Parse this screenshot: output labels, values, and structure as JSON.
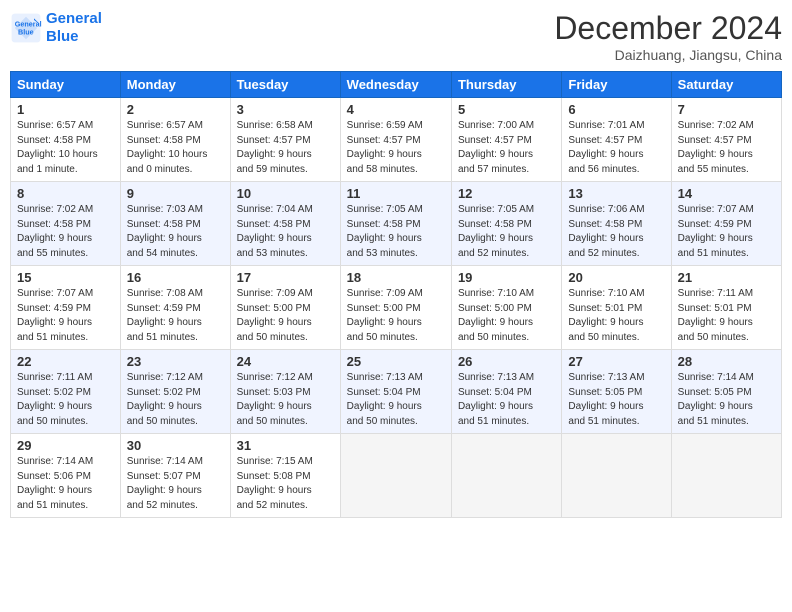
{
  "header": {
    "logo_line1": "General",
    "logo_line2": "Blue",
    "month": "December 2024",
    "location": "Daizhuang, Jiangsu, China"
  },
  "weekdays": [
    "Sunday",
    "Monday",
    "Tuesday",
    "Wednesday",
    "Thursday",
    "Friday",
    "Saturday"
  ],
  "weeks": [
    [
      {
        "day": "1",
        "info": "Sunrise: 6:57 AM\nSunset: 4:58 PM\nDaylight: 10 hours\nand 1 minute."
      },
      {
        "day": "2",
        "info": "Sunrise: 6:57 AM\nSunset: 4:58 PM\nDaylight: 10 hours\nand 0 minutes."
      },
      {
        "day": "3",
        "info": "Sunrise: 6:58 AM\nSunset: 4:57 PM\nDaylight: 9 hours\nand 59 minutes."
      },
      {
        "day": "4",
        "info": "Sunrise: 6:59 AM\nSunset: 4:57 PM\nDaylight: 9 hours\nand 58 minutes."
      },
      {
        "day": "5",
        "info": "Sunrise: 7:00 AM\nSunset: 4:57 PM\nDaylight: 9 hours\nand 57 minutes."
      },
      {
        "day": "6",
        "info": "Sunrise: 7:01 AM\nSunset: 4:57 PM\nDaylight: 9 hours\nand 56 minutes."
      },
      {
        "day": "7",
        "info": "Sunrise: 7:02 AM\nSunset: 4:57 PM\nDaylight: 9 hours\nand 55 minutes."
      }
    ],
    [
      {
        "day": "8",
        "info": "Sunrise: 7:02 AM\nSunset: 4:58 PM\nDaylight: 9 hours\nand 55 minutes."
      },
      {
        "day": "9",
        "info": "Sunrise: 7:03 AM\nSunset: 4:58 PM\nDaylight: 9 hours\nand 54 minutes."
      },
      {
        "day": "10",
        "info": "Sunrise: 7:04 AM\nSunset: 4:58 PM\nDaylight: 9 hours\nand 53 minutes."
      },
      {
        "day": "11",
        "info": "Sunrise: 7:05 AM\nSunset: 4:58 PM\nDaylight: 9 hours\nand 53 minutes."
      },
      {
        "day": "12",
        "info": "Sunrise: 7:05 AM\nSunset: 4:58 PM\nDaylight: 9 hours\nand 52 minutes."
      },
      {
        "day": "13",
        "info": "Sunrise: 7:06 AM\nSunset: 4:58 PM\nDaylight: 9 hours\nand 52 minutes."
      },
      {
        "day": "14",
        "info": "Sunrise: 7:07 AM\nSunset: 4:59 PM\nDaylight: 9 hours\nand 51 minutes."
      }
    ],
    [
      {
        "day": "15",
        "info": "Sunrise: 7:07 AM\nSunset: 4:59 PM\nDaylight: 9 hours\nand 51 minutes."
      },
      {
        "day": "16",
        "info": "Sunrise: 7:08 AM\nSunset: 4:59 PM\nDaylight: 9 hours\nand 51 minutes."
      },
      {
        "day": "17",
        "info": "Sunrise: 7:09 AM\nSunset: 5:00 PM\nDaylight: 9 hours\nand 50 minutes."
      },
      {
        "day": "18",
        "info": "Sunrise: 7:09 AM\nSunset: 5:00 PM\nDaylight: 9 hours\nand 50 minutes."
      },
      {
        "day": "19",
        "info": "Sunrise: 7:10 AM\nSunset: 5:00 PM\nDaylight: 9 hours\nand 50 minutes."
      },
      {
        "day": "20",
        "info": "Sunrise: 7:10 AM\nSunset: 5:01 PM\nDaylight: 9 hours\nand 50 minutes."
      },
      {
        "day": "21",
        "info": "Sunrise: 7:11 AM\nSunset: 5:01 PM\nDaylight: 9 hours\nand 50 minutes."
      }
    ],
    [
      {
        "day": "22",
        "info": "Sunrise: 7:11 AM\nSunset: 5:02 PM\nDaylight: 9 hours\nand 50 minutes."
      },
      {
        "day": "23",
        "info": "Sunrise: 7:12 AM\nSunset: 5:02 PM\nDaylight: 9 hours\nand 50 minutes."
      },
      {
        "day": "24",
        "info": "Sunrise: 7:12 AM\nSunset: 5:03 PM\nDaylight: 9 hours\nand 50 minutes."
      },
      {
        "day": "25",
        "info": "Sunrise: 7:13 AM\nSunset: 5:04 PM\nDaylight: 9 hours\nand 50 minutes."
      },
      {
        "day": "26",
        "info": "Sunrise: 7:13 AM\nSunset: 5:04 PM\nDaylight: 9 hours\nand 51 minutes."
      },
      {
        "day": "27",
        "info": "Sunrise: 7:13 AM\nSunset: 5:05 PM\nDaylight: 9 hours\nand 51 minutes."
      },
      {
        "day": "28",
        "info": "Sunrise: 7:14 AM\nSunset: 5:05 PM\nDaylight: 9 hours\nand 51 minutes."
      }
    ],
    [
      {
        "day": "29",
        "info": "Sunrise: 7:14 AM\nSunset: 5:06 PM\nDaylight: 9 hours\nand 51 minutes."
      },
      {
        "day": "30",
        "info": "Sunrise: 7:14 AM\nSunset: 5:07 PM\nDaylight: 9 hours\nand 52 minutes."
      },
      {
        "day": "31",
        "info": "Sunrise: 7:15 AM\nSunset: 5:08 PM\nDaylight: 9 hours\nand 52 minutes."
      },
      {
        "day": "",
        "info": ""
      },
      {
        "day": "",
        "info": ""
      },
      {
        "day": "",
        "info": ""
      },
      {
        "day": "",
        "info": ""
      }
    ]
  ]
}
